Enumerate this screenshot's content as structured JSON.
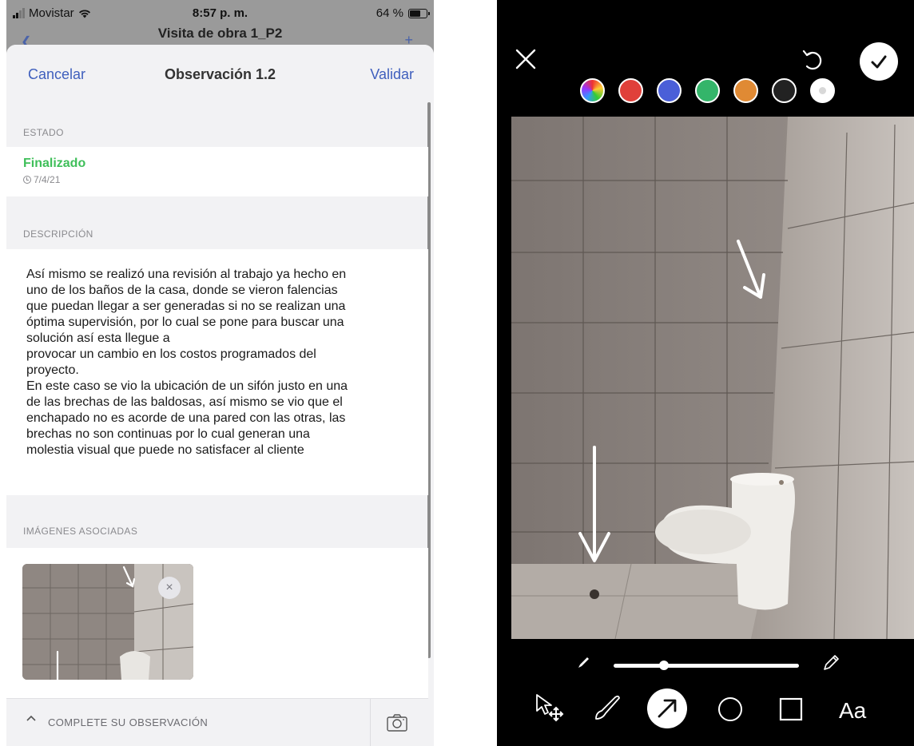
{
  "left_status": {
    "carrier": "Movistar",
    "time": "8:57 p. m.",
    "battery": "64 %"
  },
  "underlying": {
    "title": "Visita de obra 1_P2"
  },
  "nav": {
    "cancel": "Cancelar",
    "title": "Observación 1.2",
    "validate": "Validar"
  },
  "estado": {
    "header": "ESTADO",
    "value": "Finalizado",
    "date": "7/4/21",
    "value_color": "#3fbf5a"
  },
  "descripcion": {
    "header": "DESCRIPCIÓN",
    "lines": [
      "Así mismo se realizó una revisión al trabajo ya hecho en",
      "uno de los baños de la casa, donde se vieron falencias",
      "que puedan llegar a ser generadas si no se realizan una",
      "óptima supervisión, por lo cual se pone para buscar una",
      "solución así esta llegue a",
      "provocar un cambio en los costos programados del",
      "proyecto.",
      "En este caso se vio la ubicación de un sifón justo en una",
      "de las brechas de las baldosas, así mismo se vio que el",
      "enchapado no es acorde de una pared con las otras, las",
      "brechas no son continuas por lo cual generan una",
      "molestia visual que puede no satisfacer al cliente"
    ]
  },
  "imagenes": {
    "header": "IMÁGENES ASOCIADAS",
    "close_symbol": "×"
  },
  "bottom_bar": {
    "label": "COMPLETE SU OBSERVACIÓN"
  },
  "editor": {
    "colors": [
      {
        "name": "multicolor-picker",
        "value": "conic"
      },
      {
        "name": "red",
        "value": "#e0403a"
      },
      {
        "name": "blue",
        "value": "#4a5fd8"
      },
      {
        "name": "green",
        "value": "#34b56a"
      },
      {
        "name": "orange",
        "value": "#e08a34"
      },
      {
        "name": "black",
        "value": "#222222"
      },
      {
        "name": "white",
        "value": "#ffffff"
      }
    ],
    "selected_color": "white",
    "stroke_size": 0.27,
    "tools": [
      "select-move",
      "brush",
      "arrow",
      "circle",
      "rectangle",
      "text"
    ],
    "selected_tool": "arrow",
    "text_tool_label": "Aa"
  }
}
